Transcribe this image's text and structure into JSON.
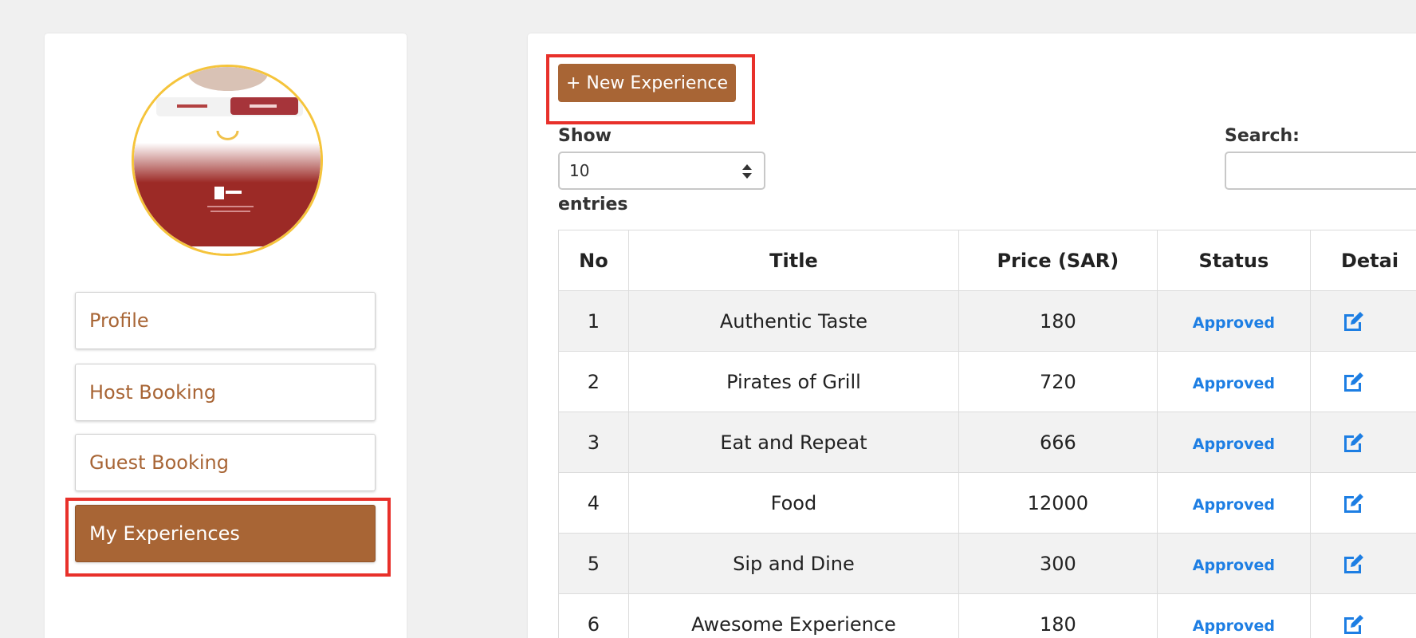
{
  "sidebar": {
    "items": [
      {
        "label": "Profile",
        "active": false
      },
      {
        "label": "Host Booking",
        "active": false
      },
      {
        "label": "Guest Booking",
        "active": false
      },
      {
        "label": "My Experiences",
        "active": true
      }
    ],
    "avatar_icon": "profile-image"
  },
  "main": {
    "new_button_label": "+ New Experience",
    "show_label": "Show",
    "entries_label": "entries",
    "page_size": "10",
    "search_label": "Search:",
    "search_value": "",
    "columns": [
      "No",
      "Title",
      "Price (SAR)",
      "Status",
      "Detai"
    ],
    "rows": [
      {
        "no": "1",
        "title": "Authentic Taste",
        "price": "180",
        "status": "Approved"
      },
      {
        "no": "2",
        "title": "Pirates of Grill",
        "price": "720",
        "status": "Approved"
      },
      {
        "no": "3",
        "title": "Eat and Repeat",
        "price": "666",
        "status": "Approved"
      },
      {
        "no": "4",
        "title": "Food",
        "price": "12000",
        "status": "Approved"
      },
      {
        "no": "5",
        "title": "Sip and Dine",
        "price": "300",
        "status": "Approved"
      },
      {
        "no": "6",
        "title": "Awesome Experience",
        "price": "180",
        "status": "Approved"
      }
    ]
  },
  "colors": {
    "accent": "#a86535",
    "highlight": "#e8302a",
    "status_approved": "#1d7ee3",
    "avatar_border": "#f5c43b"
  }
}
